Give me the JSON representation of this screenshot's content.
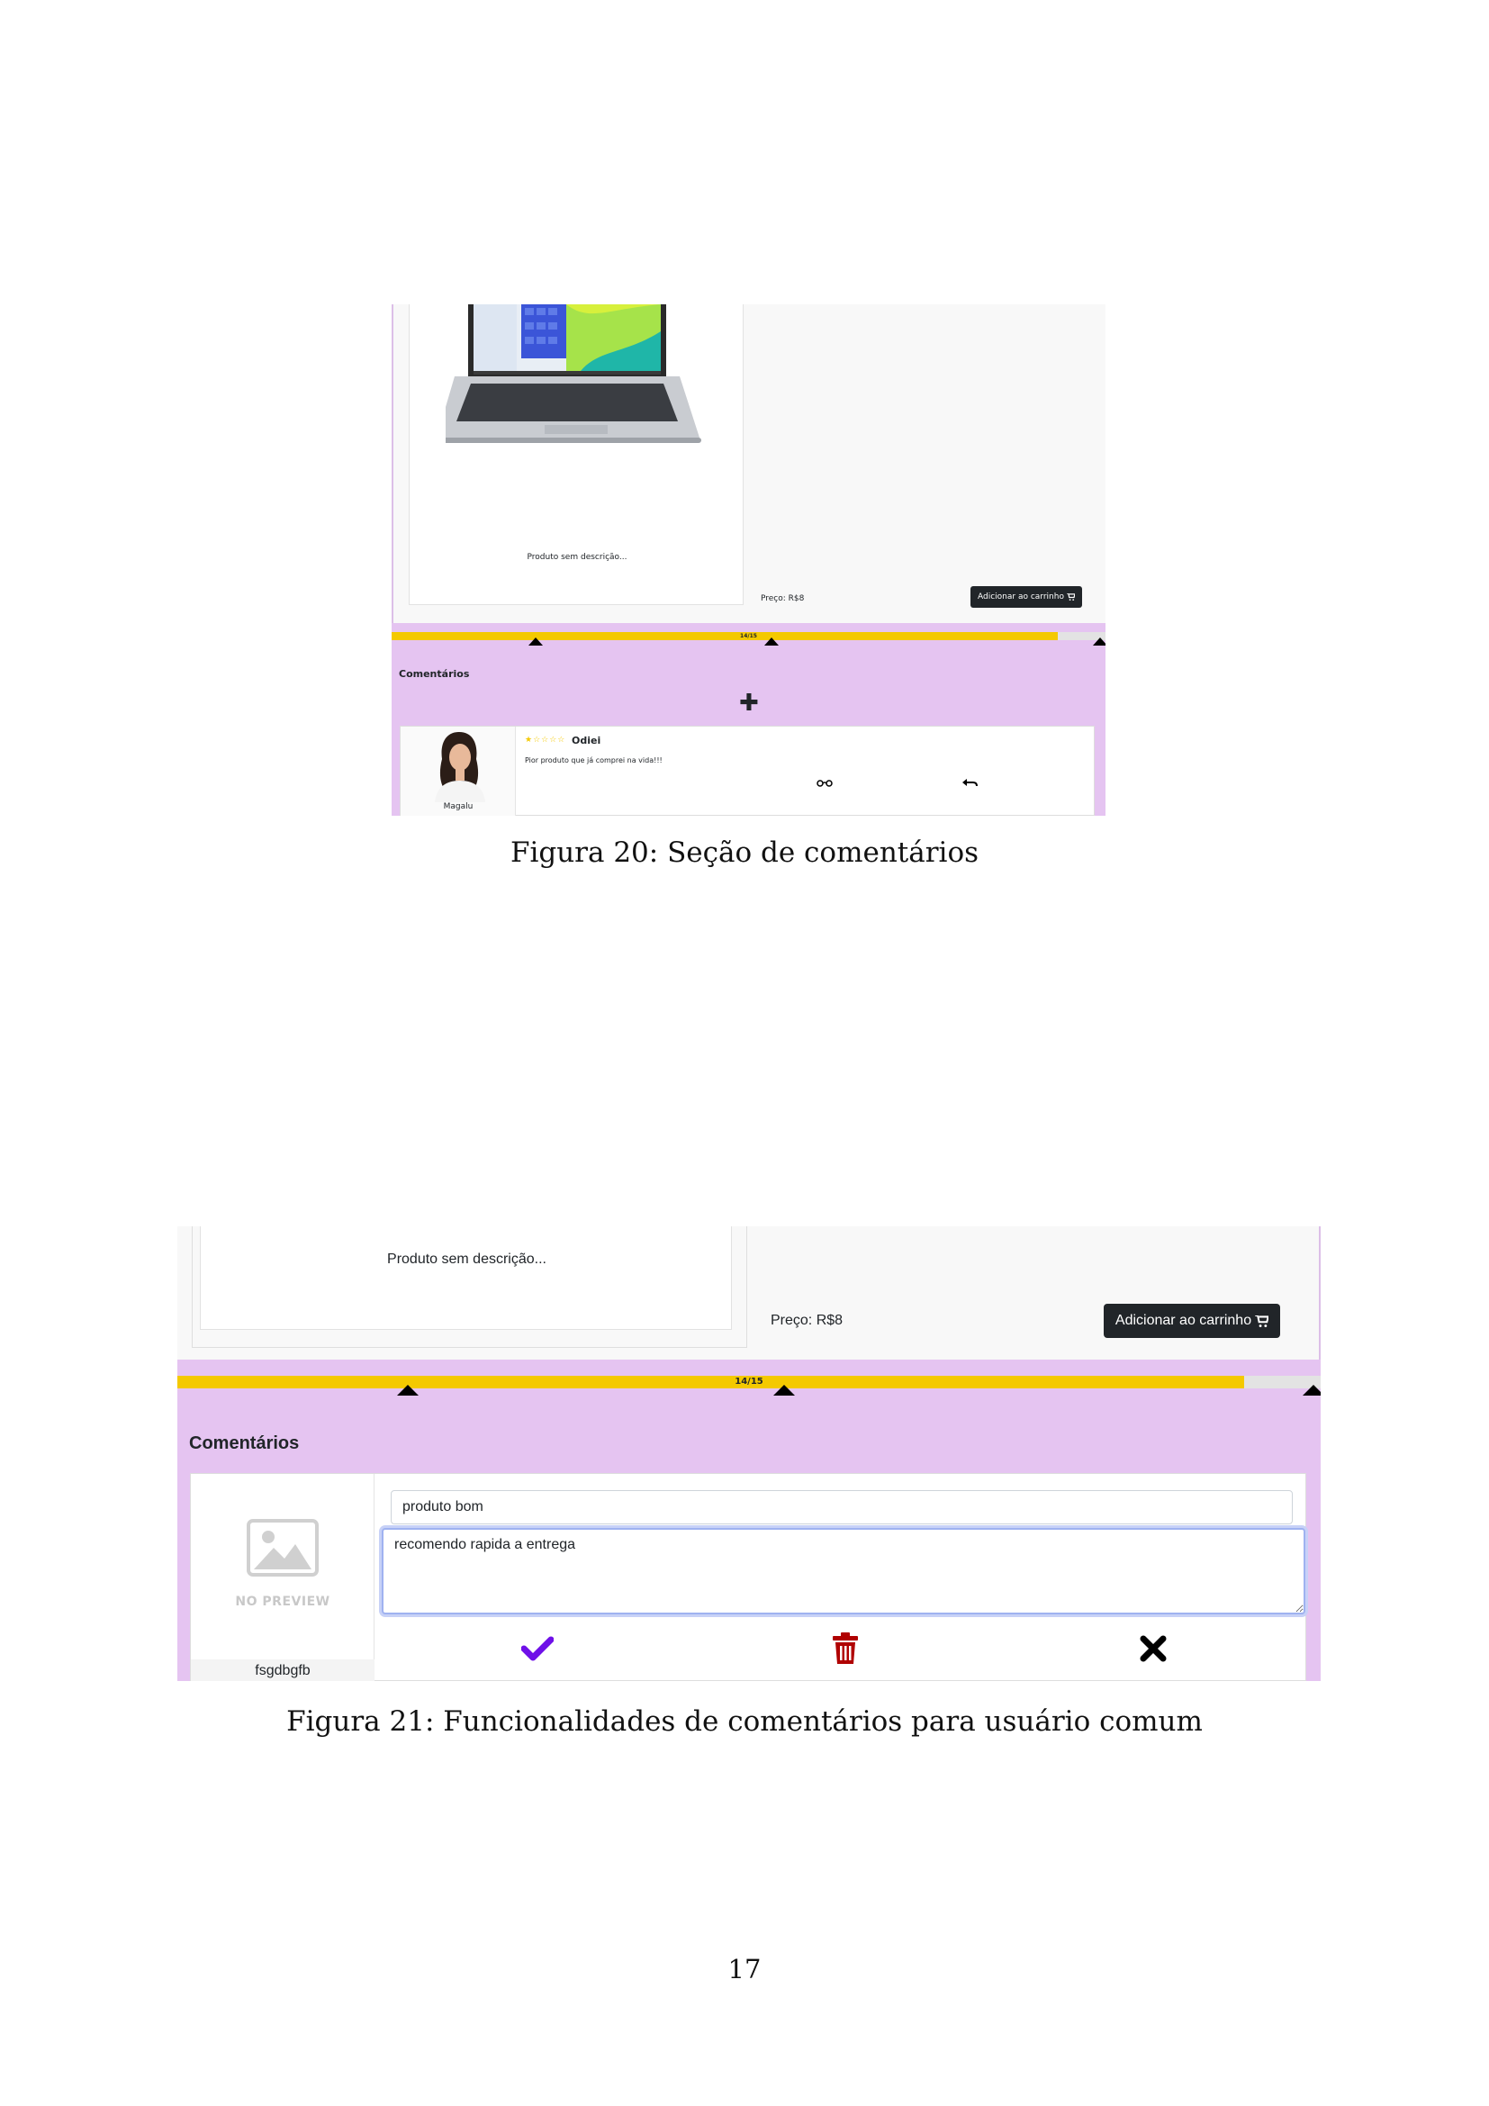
{
  "figure20": {
    "product_description": "Produto sem descrição...",
    "price_label": "Preço: R$8",
    "add_to_cart_label": "Adicionar ao carrinho",
    "cart_icon": "cart-icon",
    "progress_label": "14/15",
    "progress_fraction": 0.933,
    "comments_title": "Comentários",
    "add_comment_icon": "plus-icon",
    "comment": {
      "avatar_name": "Magalu",
      "stars": "★☆☆☆☆",
      "rating": 1,
      "author": "Odiei",
      "text": "Pior produto que já comprei na vida!!!",
      "view_icon": "glasses-icon",
      "reply_icon": "reply-icon"
    },
    "caption": "Figura 20: Seção de comentários"
  },
  "figure21": {
    "product_description": "Produto sem descrição...",
    "price_label": "Preço: R$8",
    "add_to_cart_label": "Adicionar ao carrinho",
    "progress_label": "14/15",
    "progress_fraction": 0.933,
    "comments_title": "Comentários",
    "no_preview_label": "NO PREVIEW",
    "avatar_name": "fsgdbgfb",
    "comment_title_value": "produto bom",
    "comment_text_value": "recomendo rapida a entrega",
    "confirm_icon": "check-icon",
    "delete_icon": "trash-icon",
    "cancel_icon": "close-icon",
    "colors": {
      "confirm": "#6f10e8",
      "delete": "#b00000",
      "cancel": "#000000"
    },
    "caption": "Figura 21: Funcionalidades de comentários para usuário comum"
  },
  "colors": {
    "panel": "#e5c4f1",
    "progress_fill": "#f4c900",
    "button_dark": "#212529"
  },
  "page_number": "17"
}
